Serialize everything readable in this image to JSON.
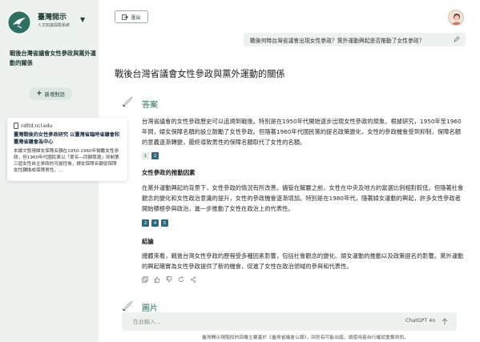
{
  "sidebar": {
    "brand_title": "臺灣開示",
    "brand_subtitle": "人文知識探勘系統",
    "conversation_title": "戰後台灣省議會女性參政與黨外運動的關係",
    "new_chat_label": "新增對話"
  },
  "source_card": {
    "domain": "ndltd.ncl.edu",
    "title": "臺灣戰後的女性參政研究 以臺灣省臨時省議會和臺灣省議會為中心",
    "snippet": "本論文發現婦女保障名額在1950-1960年鼓勵女性參政，但1960年代國民黨以「提名—同額競選」抑制第三屆女性自主參政的可能性後，婦女保障名額從保障女性轉換成保障男性，..."
  },
  "header": {
    "exit_label": "匯出",
    "user_query": "戰後何時台灣省議會出現女性參政？黨外運動興起是否推動了女性參政？"
  },
  "main": {
    "page_title": "戰後台灣省議會女性參政與黨外運動的關係",
    "answer_heading": "答案",
    "para1": "台灣省議會的女性參政歷史可以追溯到戰後。特別是在1950年代開始逐步出現女性參政的現象。根據研究，1950年至1960年間，婦女保障名額的設立鼓勵了女性參政。但隨著1960年代國民黨的提名政策變化，女性的參政機會受到抑制，保障名額的意義逐漸轉變，最終導致男性的保障名額取代了女性的名額。",
    "cites1": [
      "1",
      "2"
    ],
    "subhead1": "女性參政的推動因素",
    "para2": "在黨外運動興起的背景下，女性參政的情況有所改善。儘管在解嚴之前，女性在中央及地方的當選比例相對較低，但隨著社會觀念的變化和女性政治意識的提升，女性的參政機會逐漸增加。特別是在1980年代，隨著婦女運動的興起，許多女性參政者開始積極參與政治，進一步推動了女性在政治上的代表性。",
    "cites2": [
      "2",
      "4",
      "5"
    ],
    "subhead2": "結論",
    "para3": "總體來看，戰後台灣女性參政的歷程受多種因素影響，包括社會觀念的變化、婦女運動的推動以及政策提名的影響。黨外運動的興起確實為女性參政提供了新的機會，促進了女性在政治領域的參與和代表性。",
    "images_heading": "圖片"
  },
  "composer": {
    "placeholder": "在此輸入...",
    "model_label": "ChatGPT 4o",
    "disclaimer": "臺灣開示現階段的回覆主要基於《臺灣省議會公報》，回答有可能出錯，請使用者自行確認重要資訊。"
  },
  "colors": {
    "accent": "#2a6b5c",
    "sidebar_bg": "#eef2ef",
    "cite_filled": "#2e6a83"
  }
}
